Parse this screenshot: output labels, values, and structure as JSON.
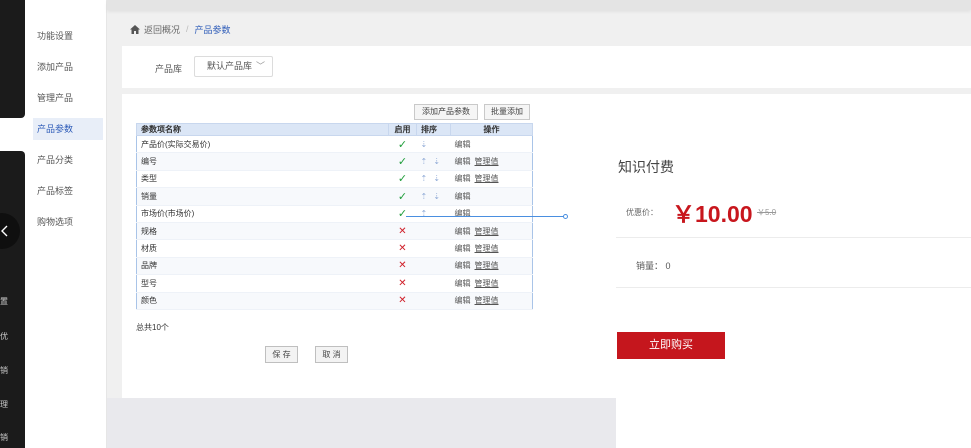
{
  "rail": {
    "labels": [
      "置",
      "优",
      "销",
      "理",
      "销"
    ]
  },
  "submenu": {
    "items": [
      "功能设置",
      "添加产品",
      "管理产品",
      "产品参数",
      "产品分类",
      "产品标签",
      "购物选项"
    ]
  },
  "breadcrumb": {
    "home": "返回概况",
    "sep": "/",
    "current": "产品参数"
  },
  "library": {
    "label": "产品库",
    "selected": "默认产品库",
    "chevron": "﹀"
  },
  "toolbar": {
    "add_param": "添加产品参数",
    "batch_add": "批量添加"
  },
  "table": {
    "headers": [
      "参数项名称",
      "启用",
      "排序",
      "操作"
    ],
    "rows": [
      {
        "name": "产品价(实际交易价)",
        "enabled": "✓",
        "sort": "⇣",
        "ops": [
          "编辑",
          ""
        ]
      },
      {
        "name": "编号",
        "enabled": "✓",
        "sort": "⇡ ⇣",
        "ops": [
          "编辑",
          "管理值"
        ]
      },
      {
        "name": "类型",
        "enabled": "✓",
        "sort": "⇡ ⇣",
        "ops": [
          "编辑",
          "管理值"
        ]
      },
      {
        "name": "销量",
        "enabled": "✓",
        "sort": "⇡ ⇣",
        "ops": [
          "编辑",
          ""
        ]
      },
      {
        "name": "市场价(市场价)",
        "enabled": "✓",
        "sort": "⇡",
        "ops": [
          "编辑",
          ""
        ]
      },
      {
        "name": "规格",
        "enabled": "✕",
        "sort": "",
        "ops": [
          "编辑",
          "管理值"
        ]
      },
      {
        "name": "材质",
        "enabled": "✕",
        "sort": "",
        "ops": [
          "编辑",
          "管理值"
        ]
      },
      {
        "name": "品牌",
        "enabled": "✕",
        "sort": "",
        "ops": [
          "编辑",
          "管理值"
        ]
      },
      {
        "name": "型号",
        "enabled": "✕",
        "sort": "",
        "ops": [
          "编辑",
          "管理值"
        ]
      },
      {
        "name": "颜色",
        "enabled": "✕",
        "sort": "",
        "ops": [
          "编辑",
          "管理值"
        ]
      }
    ]
  },
  "total": "总共10个",
  "actions": {
    "save": "保 存",
    "cancel": "取 消"
  },
  "preview": {
    "title": "知识付费",
    "price_label": "优惠价：",
    "price": "￥10.00",
    "original_price": "￥5.0",
    "sales": "销量： 0",
    "buy": "立即购买"
  },
  "icons": {
    "home": "home-icon",
    "collapse": "chevron-left-icon"
  },
  "colors": {
    "accent_blue": "#2d5bb8",
    "price_red": "#c8161d",
    "buy_red": "#c5161d",
    "check_green": "#1f9d3a",
    "cross_red": "#d0202a"
  }
}
